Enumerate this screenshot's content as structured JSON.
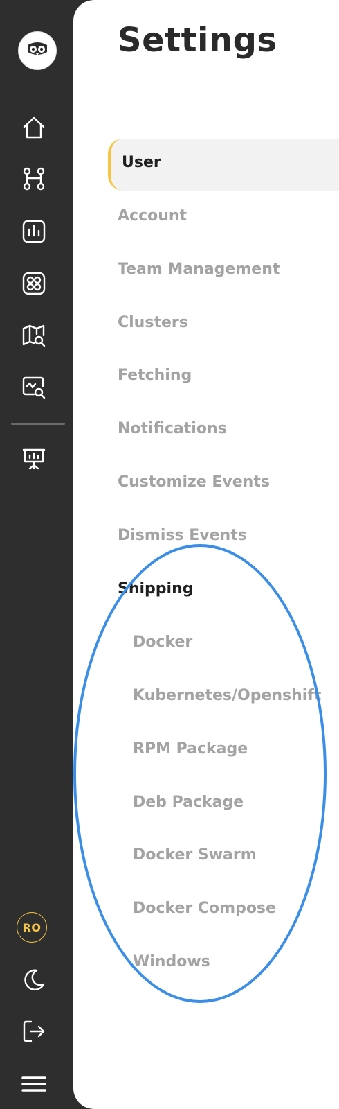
{
  "sidebar": {
    "logo_icon": "owl-logo-icon",
    "nav_icons": [
      "home-icon",
      "flow-icon",
      "chart-icon",
      "dashboards-icon",
      "map-search-icon",
      "monitor-search-icon"
    ],
    "extra_icons": [
      "presentation-icon"
    ],
    "bottom": {
      "avatar_initials": "RO",
      "theme_icon": "moon-icon",
      "logout_icon": "logout-icon",
      "menu_icon": "hamburger-icon"
    },
    "colors": {
      "background": "#2e2e2e",
      "accent": "#f6c544"
    }
  },
  "page": {
    "title": "Settings"
  },
  "settings_menu": {
    "active_item": "User",
    "items": [
      "Account",
      "Team Management",
      "Clusters",
      "Fetching",
      "Notifications",
      "Customize Events",
      "Dismiss Events"
    ],
    "section_heading": "Shipping",
    "sub_items": [
      "Docker",
      "Kubernetes/Openshift",
      "RPM Package",
      "Deb Package",
      "Docker Swarm",
      "Docker Compose",
      "Windows"
    ]
  },
  "annotation": {
    "color": "#3a8ee8"
  }
}
